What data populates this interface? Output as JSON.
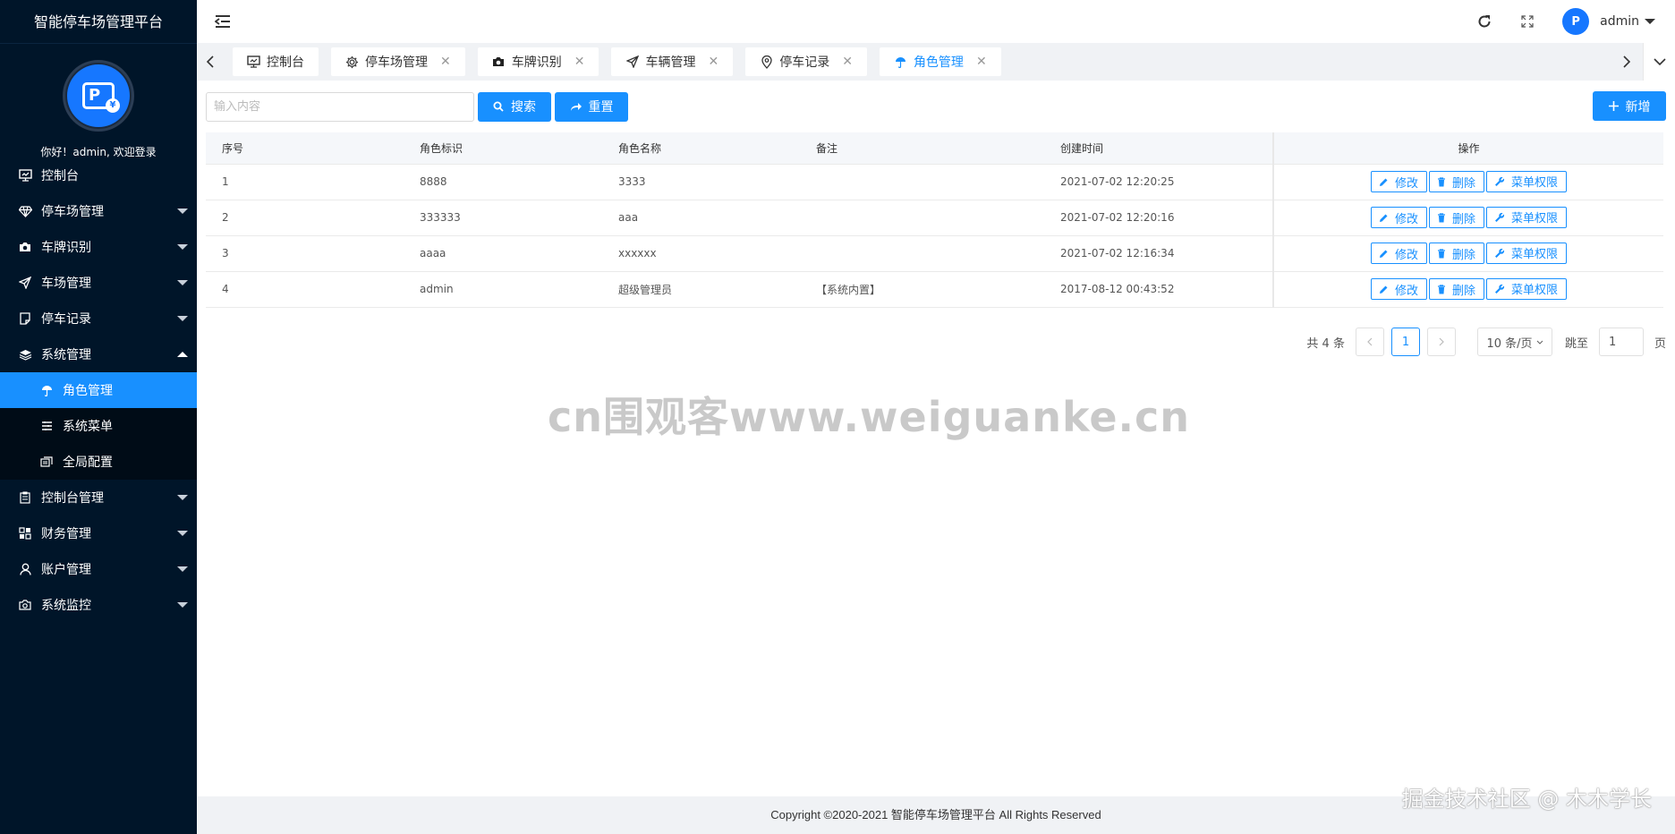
{
  "sidebar": {
    "brand": "智能停车场管理平台",
    "welcome": "你好！admin, 欢迎登录",
    "items": [
      {
        "label": "控制台",
        "icon": "monitor-icon"
      },
      {
        "label": "停车场管理",
        "icon": "diamond-icon"
      },
      {
        "label": "车牌识别",
        "icon": "camera-icon"
      },
      {
        "label": "车场管理",
        "icon": "send-icon"
      },
      {
        "label": "停车记录",
        "icon": "note-icon"
      },
      {
        "label": "系统管理",
        "icon": "layers-icon"
      }
    ],
    "sub_items": [
      {
        "label": "角色管理",
        "icon": "umbrella-icon"
      },
      {
        "label": "系统菜单",
        "icon": "list-icon"
      },
      {
        "label": "全局配置",
        "icon": "config-icon"
      }
    ],
    "items_after": [
      {
        "label": "控制台管理",
        "icon": "clipboard-icon"
      },
      {
        "label": "财务管理",
        "icon": "grid-icon"
      },
      {
        "label": "账户管理",
        "icon": "user-icon"
      },
      {
        "label": "系统监控",
        "icon": "camera-icon"
      }
    ]
  },
  "header": {
    "user": "admin",
    "avatar_text": "P"
  },
  "tabs": [
    {
      "label": "控制台",
      "icon": "monitor-icon",
      "closable": false
    },
    {
      "label": "停车场管理",
      "icon": "gear-icon",
      "closable": true
    },
    {
      "label": "车牌识别",
      "icon": "camera-icon",
      "closable": true
    },
    {
      "label": "车辆管理",
      "icon": "send-icon",
      "closable": true
    },
    {
      "label": "停车记录",
      "icon": "location-icon",
      "closable": true
    },
    {
      "label": "角色管理",
      "icon": "umbrella-icon",
      "closable": true,
      "active": true
    }
  ],
  "toolbar": {
    "search_placeholder": "输入内容",
    "search_label": "搜索",
    "reset_label": "重置",
    "add_label": "新增"
  },
  "table": {
    "columns": [
      "序号",
      "角色标识",
      "角色名称",
      "备注",
      "创建时间",
      "操作"
    ],
    "rows": [
      {
        "index": "1",
        "key": "8888",
        "name": "3333",
        "note": "",
        "created": "2021-07-02 12:20:25"
      },
      {
        "index": "2",
        "key": "333333",
        "name": "aaa",
        "note": "",
        "created": "2021-07-02 12:20:16"
      },
      {
        "index": "3",
        "key": "aaaa",
        "name": "xxxxxx",
        "note": "",
        "created": "2021-07-02 12:16:34"
      },
      {
        "index": "4",
        "key": "admin",
        "name": "超级管理员",
        "note": "【系统内置】",
        "created": "2017-08-12 00:43:52"
      }
    ],
    "actions": {
      "edit": "修改",
      "delete": "删除",
      "perm": "菜单权限"
    }
  },
  "pagination": {
    "total_text": "共 4 条",
    "current_page": "1",
    "page_size": "10 条/页",
    "jump_label": "跳至",
    "jump_value": "1",
    "page_unit": "页"
  },
  "watermark": "cn围观客www.weiguanke.cn",
  "corner_mark": "掘金技术社区 @ 木木学长",
  "footer": "Copyright ©2020-2021 智能停车场管理平台 All Rights Reserved",
  "colors": {
    "primary": "#1890ff",
    "sidebar": "#001529",
    "submenu": "#000c17"
  }
}
